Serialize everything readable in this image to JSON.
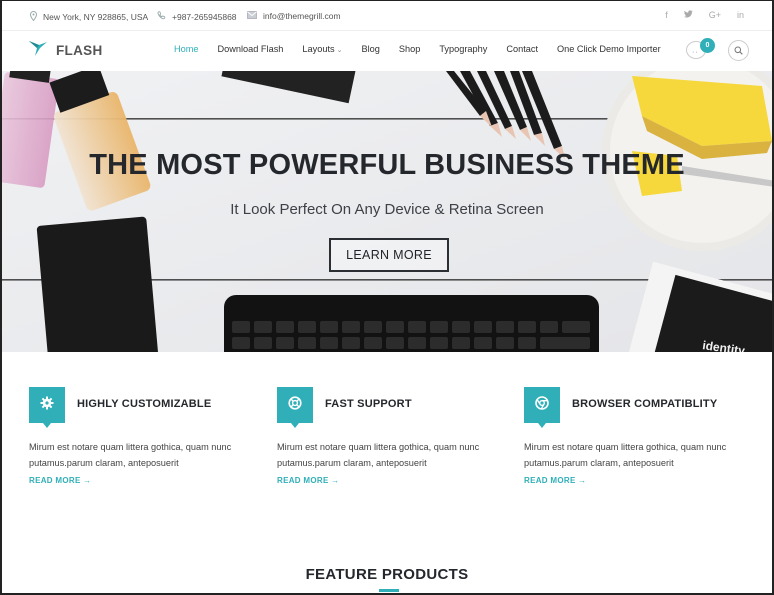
{
  "topbar": {
    "location": "New York, NY 928865, USA",
    "phone": "+987-265945868",
    "email": "info@themegrill.com",
    "social": [
      "f",
      "✳",
      "G+",
      "in"
    ]
  },
  "header": {
    "logo_text": "FLASH",
    "nav": [
      {
        "label": "Home",
        "active": true
      },
      {
        "label": "Download Flash"
      },
      {
        "label": "Layouts",
        "has_dropdown": true
      },
      {
        "label": "Blog"
      },
      {
        "label": "Shop"
      },
      {
        "label": "Typography"
      },
      {
        "label": "Contact"
      },
      {
        "label": "One Click Demo Importer"
      }
    ],
    "cart_count": "0",
    "chevron": "⌄"
  },
  "hero": {
    "title": "THE MOST POWERFUL BUSINESS THEME",
    "subtitle": "It Look Perfect On Any Device & Retina Screen",
    "button": "LEARN MORE",
    "book_text": "identity"
  },
  "features": [
    {
      "icon": "gear-icon",
      "title": "HIGHLY CUSTOMIZABLE",
      "text": "Mirum est notare quam littera gothica, quam nunc putamus.parum claram, anteposuerit",
      "link": "READ MORE →"
    },
    {
      "icon": "lifebuoy-icon",
      "title": "FAST SUPPORT",
      "text": "Mirum est notare quam littera gothica, quam nunc putamus.parum claram, anteposuerit",
      "link": "READ MORE →"
    },
    {
      "icon": "chrome-icon",
      "title": "BROWSER COMPATIBLITY",
      "text": "Mirum est notare quam littera gothica, quam nunc putamus.parum claram, anteposuerit",
      "link": "READ MORE →"
    }
  ],
  "section": {
    "title": "FEATURE PRODUCTS"
  },
  "colors": {
    "accent": "#30afb8",
    "dark": "#24272c"
  }
}
